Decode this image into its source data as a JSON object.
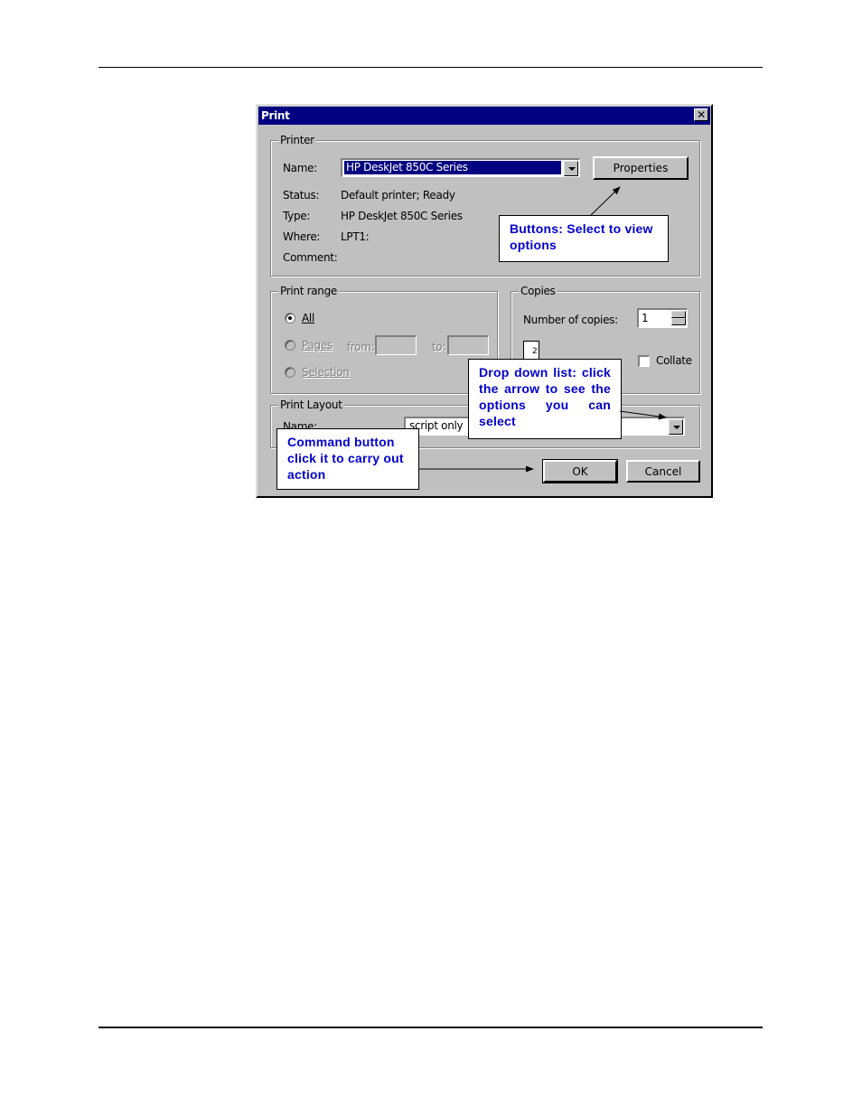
{
  "dialog": {
    "title": "Print",
    "close_glyph": "✕",
    "printer_group": {
      "label": "Printer",
      "name_label": "Name:",
      "name_value": "HP DeskJet 850C Series",
      "properties_label": "Properties",
      "status_label": "Status:",
      "status_value": "Default printer; Ready",
      "type_label": "Type:",
      "type_value": "HP DeskJet 850C Series",
      "where_label": "Where:",
      "where_value": "LPT1:",
      "comment_label": "Comment:"
    },
    "print_range": {
      "label": "Print range",
      "all_label": "All",
      "pages_label": "Pages",
      "from_label": "from:",
      "to_label": "to:",
      "selection_label": "Selection",
      "selected": "all"
    },
    "copies": {
      "label": "Copies",
      "number_label": "Number of copies:",
      "number_value": "1",
      "collate_label": "Collate",
      "collate_checked": false,
      "page_icon_number": "2"
    },
    "print_layout": {
      "label": "Print Layout",
      "name_label": "Name:",
      "name_value": "script only"
    },
    "ok_label": "OK",
    "cancel_label": "Cancel"
  },
  "callouts": {
    "buttons": "Buttons: Select to view options",
    "dropdown": "Drop down list: click the arrow to see the options you can select",
    "command": "Command button click it to carry out action"
  },
  "colors": {
    "title_bar": "#000080",
    "dialog_face": "#c0c0c0",
    "callout_text": "#0000cc"
  }
}
